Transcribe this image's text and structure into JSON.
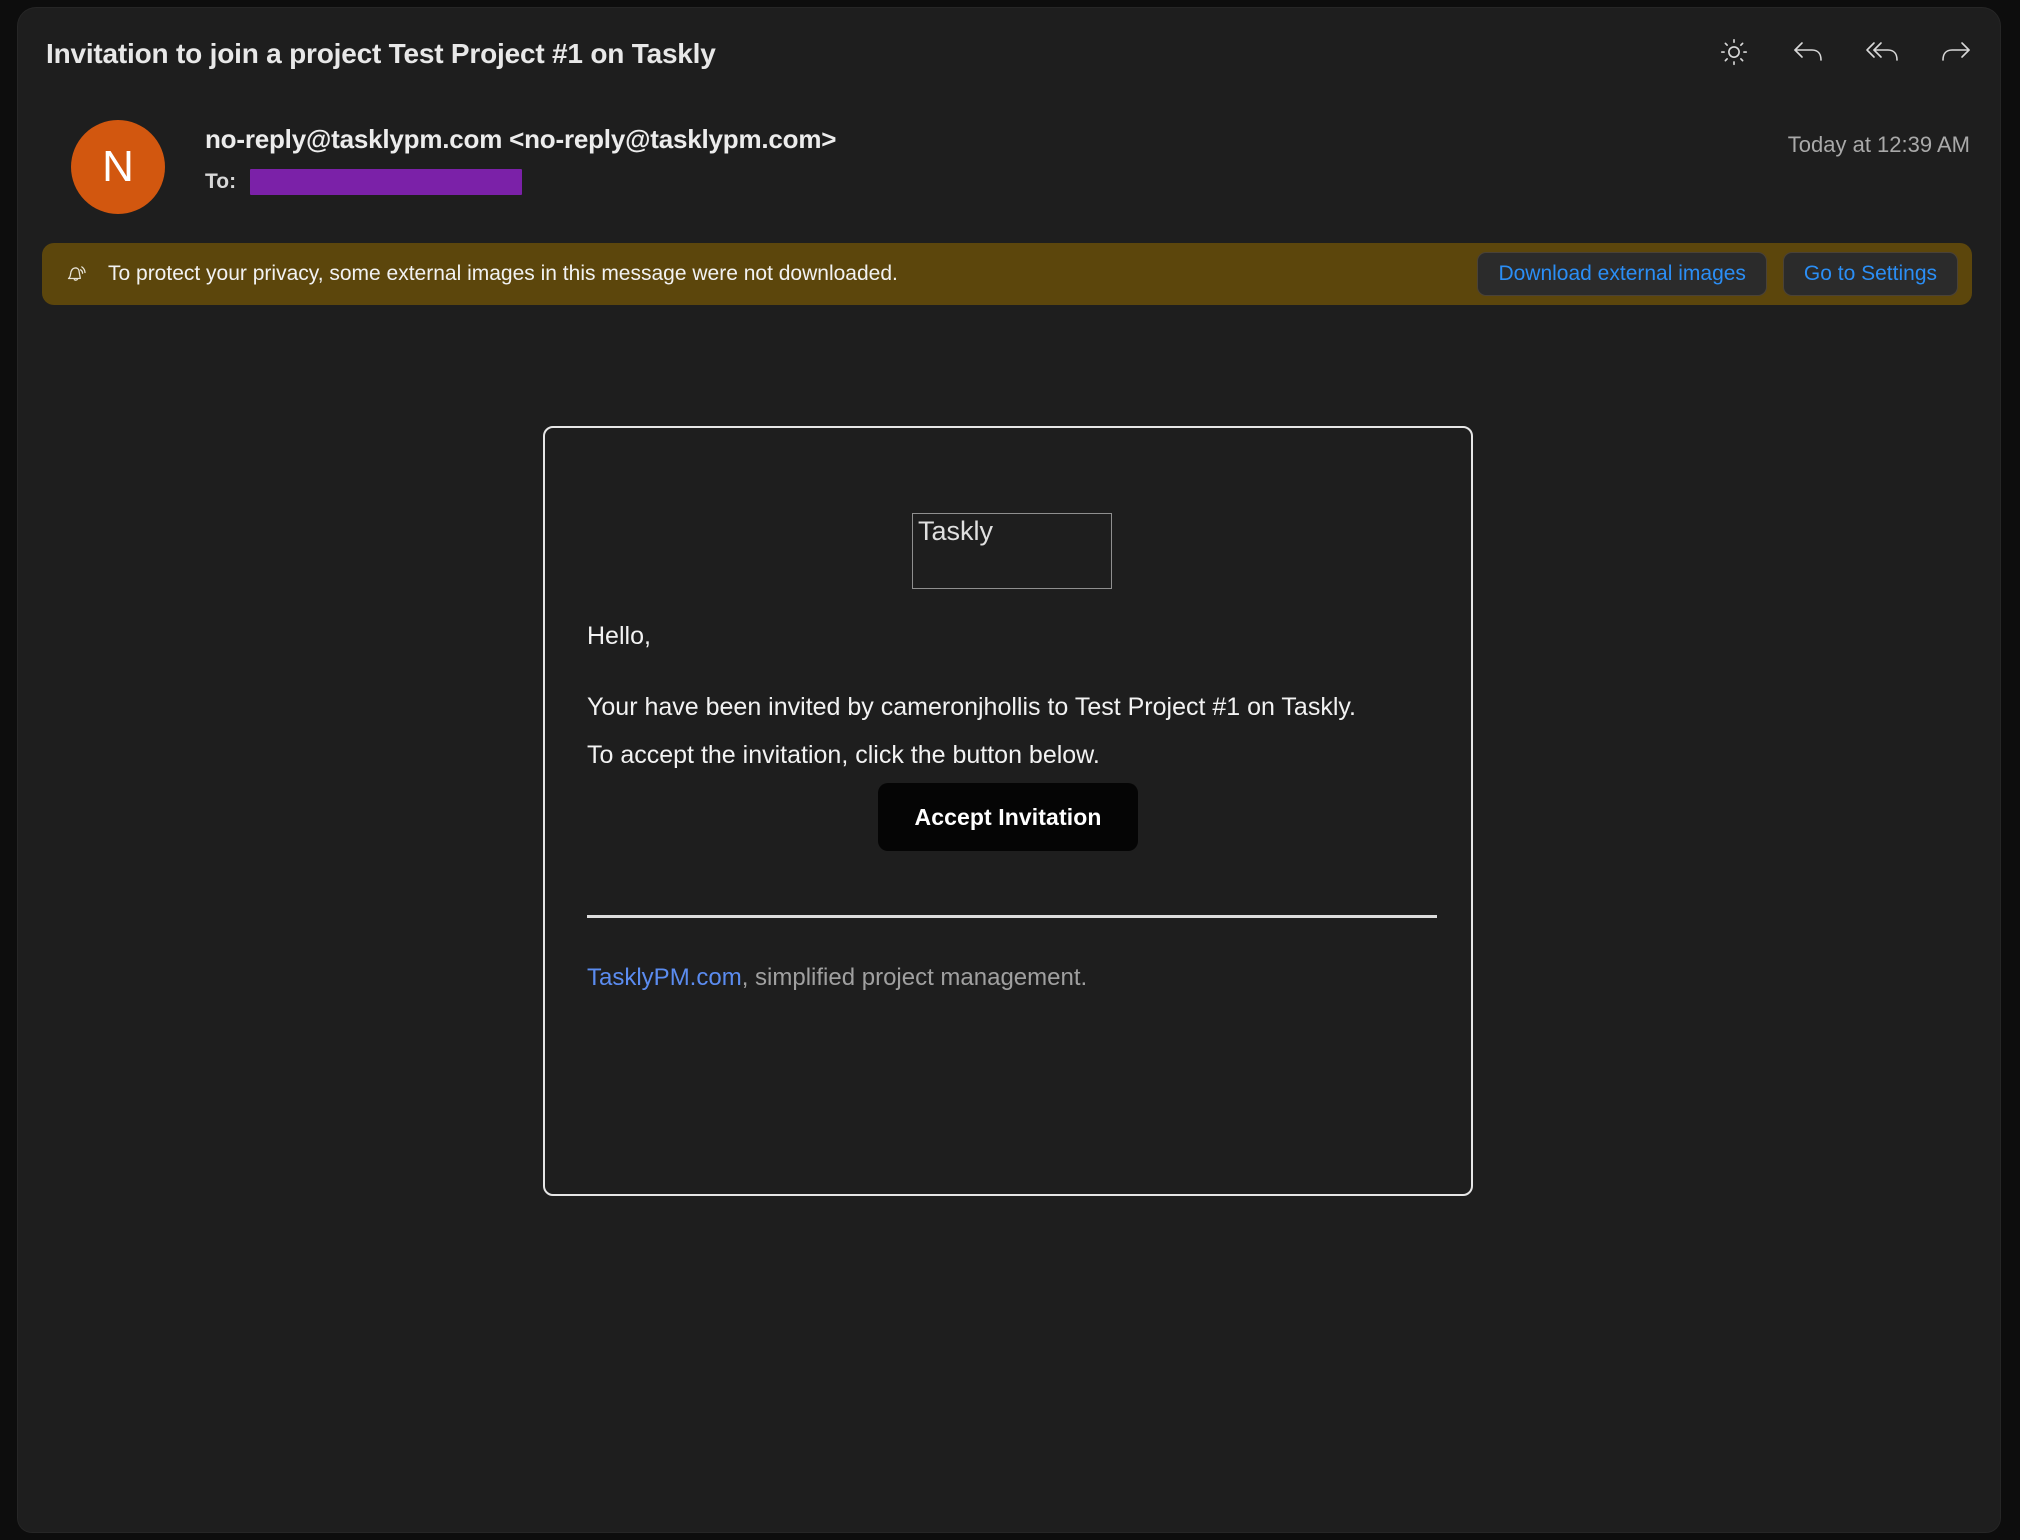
{
  "window": {
    "subject": "Invitation to join a project Test Project #1 on Taskly"
  },
  "toolbar": {
    "items": [
      {
        "name": "brightness-icon",
        "label": "Adjust brightness"
      },
      {
        "name": "reply-icon",
        "label": "Reply"
      },
      {
        "name": "reply-all-icon",
        "label": "Reply all"
      },
      {
        "name": "forward-icon",
        "label": "Forward"
      }
    ]
  },
  "sender": {
    "avatar_initial": "N",
    "avatar_color": "#d2570f",
    "address": "no-reply@tasklypm.com <no-reply@tasklypm.com>",
    "to_label": "To:",
    "to_value": "",
    "to_redaction_color": "#7b21a8",
    "timestamp": "Today at 12:39 AM"
  },
  "privacy_banner": {
    "icon": "bell-alert-icon",
    "message": "To protect your privacy, some external images in this message were not downloaded.",
    "background_color": "#5c460c",
    "link_color": "#2b8ef5",
    "download_button": "Download external images",
    "settings_button": "Go to Settings"
  },
  "email": {
    "logo_alt_text": "Taskly",
    "greeting": "Hello,",
    "paragraph_line1": "Your have been invited by cameronjhollis to Test Project #1 on Taskly.",
    "paragraph_line2": "To accept the invitation, click the button below.",
    "cta_label": "Accept Invitation",
    "footer_link": "TasklyPM.com",
    "footer_rest": ", simplified project management."
  }
}
